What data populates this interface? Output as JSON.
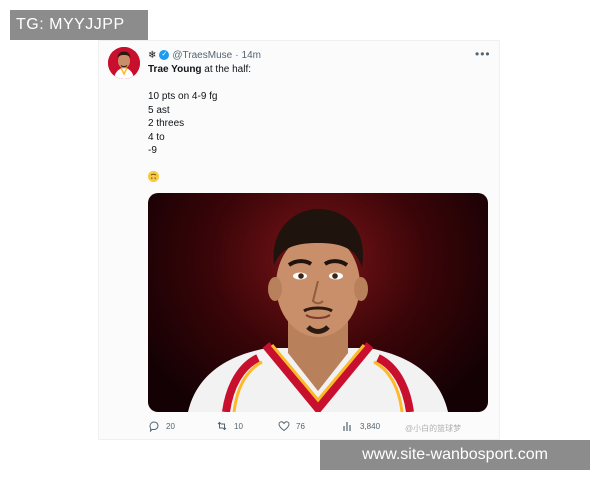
{
  "overlays": {
    "tg_label": "TG: MYYJJPP",
    "site_label": "www.site-wanbosport.com"
  },
  "tweet": {
    "name_glyph": "❄",
    "handle": "@TraesMuse",
    "separator": "·",
    "time": "14m",
    "more": "•••",
    "headline_name": "Trae Young",
    "headline_rest": " at the half:",
    "stats": [
      "10 pts on 4-9 fg",
      "5 ast",
      "2 threes",
      "4 to",
      "-9"
    ],
    "emoji": "🙃"
  },
  "actions": {
    "replies": "20",
    "retweets": "10",
    "likes": "76",
    "views": "3,840"
  },
  "watermark": "@小白的篮球梦",
  "colors": {
    "accent": "#1d9bf0",
    "jersey_red": "#c8102e",
    "jersey_yellow": "#fdb927"
  }
}
